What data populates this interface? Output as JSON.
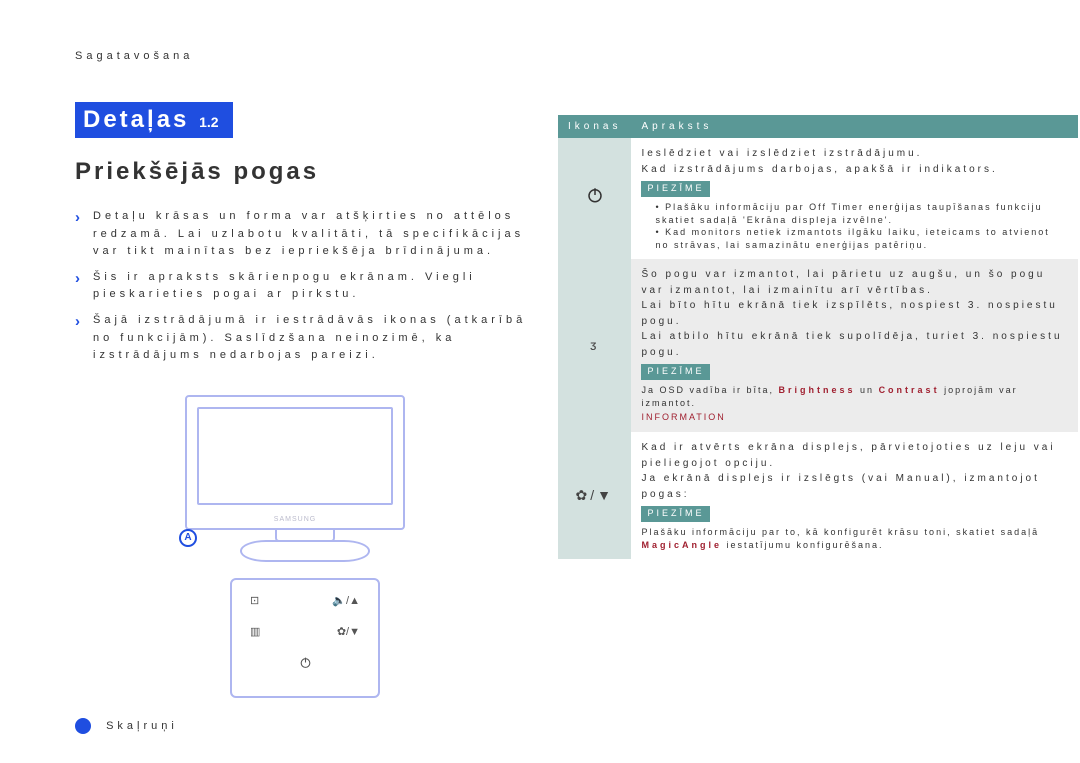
{
  "chapter": "Sagatavošana",
  "title": "Detaļas",
  "section": "Priekšējās pogas",
  "bullets": [
    "Detaļu krāsas un forma var atšķirties no attēlos redzamā. Lai uzlabotu kvalitāti, tā specifikācijas var tikt mainītas bez iepriekšēja brīdinājuma.",
    "Šis ir apraksts skārienpogu ekrānam. Viegli pieskarieties pogai ar pirkstu.",
    "Šajā izstrādājumā ir iestrādāvās ikonas (atkarībā no funkcijām). Saslīdzšana neinozimē, ka izstrādājums nedarbojas pareizi."
  ],
  "brand": "SAMSUNG",
  "markerA": "A",
  "speakerLabel": "Skaļruņi",
  "table": {
    "col1": "Ikonas",
    "col2": "Apraksts",
    "r1_l1": "Ieslēdziet vai izslēdziet izstrādājumu.",
    "r1_l2": "Kad izstrādājums darbojas, apakšā ir indikators.",
    "r1_note": "PIEZĪME",
    "r1_s1": "Plašāku informāciju par Off Timer enerģijas taupīšanas funkciju skatiet sadaļā 'Ekrāna displeja izvēlne'.",
    "r1_s2": "Kad monitors netiek izmantots ilgāku laiku, ieteicams to atvienot no strāvas, lai samazinātu enerģijas patēriņu.",
    "r2_symbol": "ᴣ",
    "r2_l1": "Šo pogu var izmantot, lai pārietu uz augšu, un šo pogu var izmantot, lai izmainītu arī vērtības.",
    "r2_l2": "Lai bīto hītu ekrānā tiek izspīlēts, nospiest 3. nospiestu pogu.",
    "r2_l3": "Lai atbilo hītu ekrānā tiek supolīdēja, turiet 3. nospiestu pogu.",
    "r2_note": "PIEZĪME",
    "r2_s1": "Ja OSD vadība ir bīta, ",
    "r2_hi1": "Brightness",
    "r2_s1b": " un ",
    "r2_hi1b": "Contrast",
    "r2_s1c": " joprojām var izmantot.",
    "r2_info": "INFORMATION",
    "r3_icon": "✿/▼",
    "r3_l1": "Kad ir atvērts ekrāna displejs, pārvietojoties uz leju vai pieliegojot opciju.",
    "r3_l2": "Ja ekrānā displejs ir izslēgts (vai Manual), izmantojot pogas: ",
    "r3_note": "PIEZĪME",
    "r3_s1": "Plašāku informāciju par to, kā konfigurēt krāsu toni, skatiet sadaļā ",
    "r3_hi2": "MagicAngle",
    "r3_s1b": " iestatījumu konfigurēšana."
  }
}
